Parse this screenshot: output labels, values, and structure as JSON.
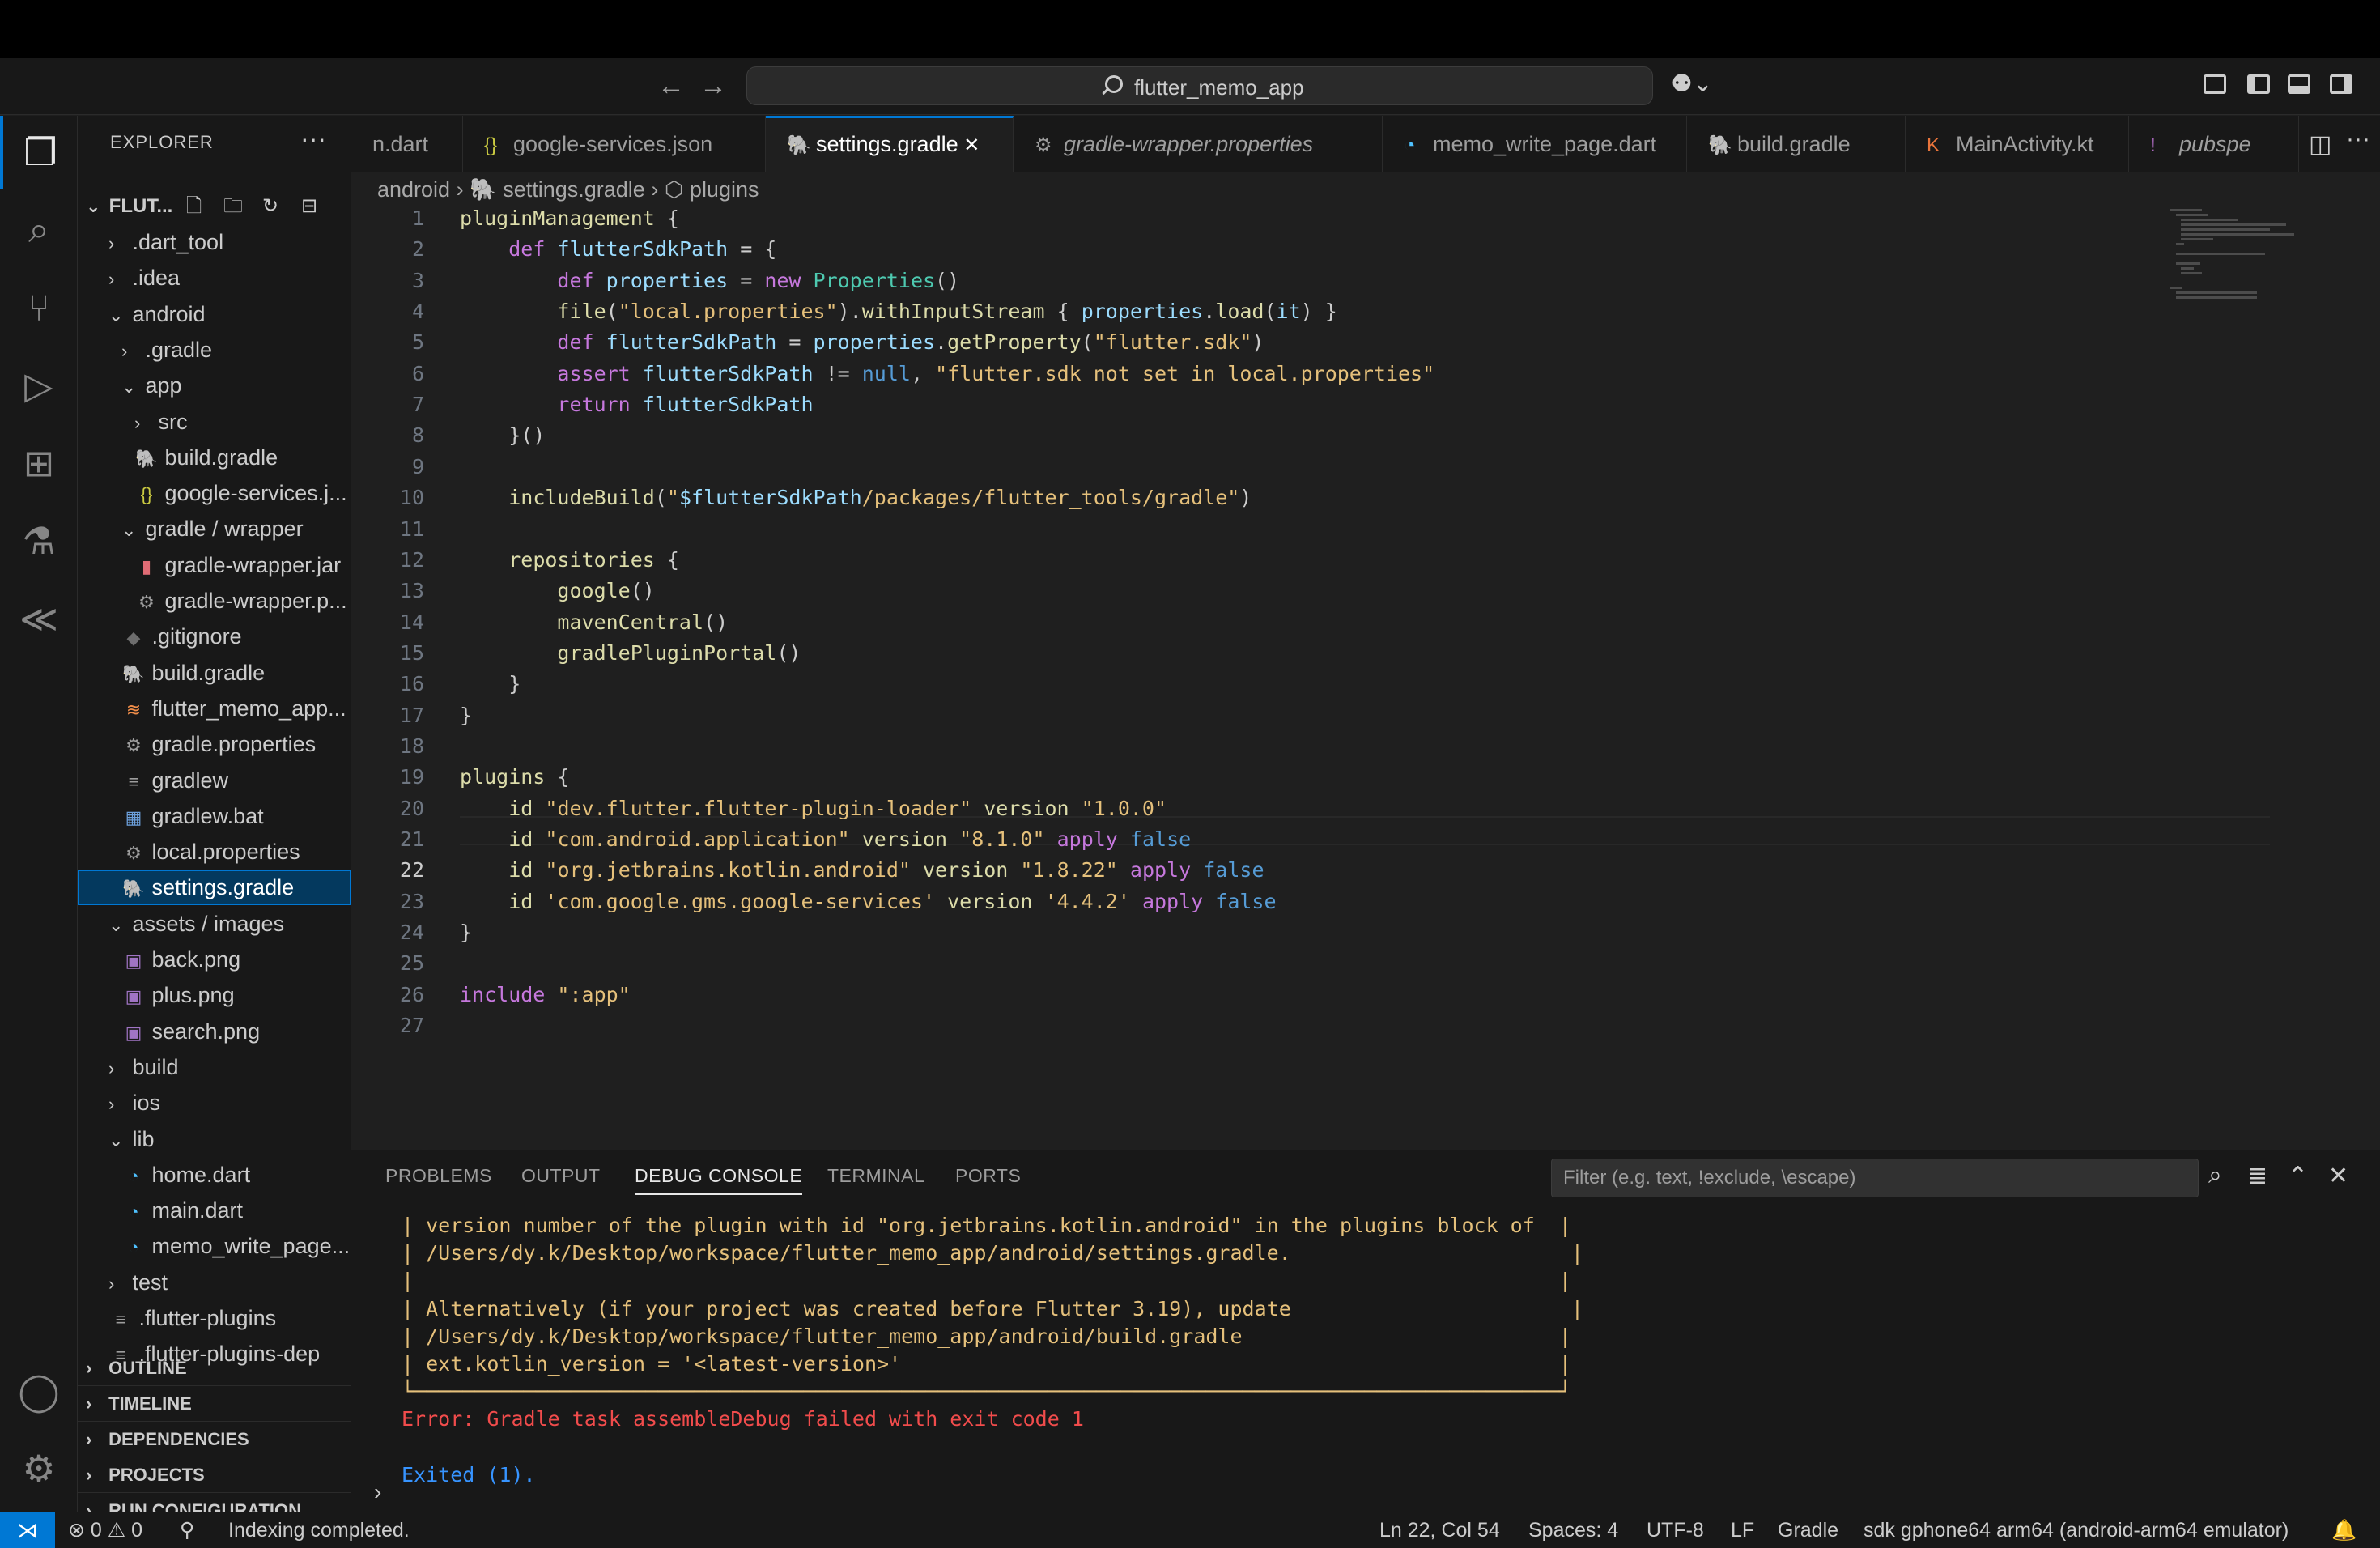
{
  "titlebar": {
    "search_text": "flutter_memo_app"
  },
  "sidebar": {
    "title": "EXPLORER",
    "root_label": "FLUT...",
    "tree": [
      {
        "label": ".dart_tool",
        "chev": "›",
        "icon": "",
        "indent": 0
      },
      {
        "label": ".idea",
        "chev": "›",
        "icon": "",
        "indent": 0
      },
      {
        "label": "android",
        "chev": "⌄",
        "icon": "",
        "indent": 0
      },
      {
        "label": ".gradle",
        "chev": "›",
        "icon": "",
        "indent": 1
      },
      {
        "label": "app",
        "chev": "⌄",
        "icon": "",
        "indent": 1
      },
      {
        "label": "src",
        "chev": "›",
        "icon": "",
        "indent": 2
      },
      {
        "label": "build.gradle",
        "chev": "",
        "icon": "🐘",
        "indent": 2
      },
      {
        "label": "google-services.j...",
        "chev": "",
        "icon": "{}",
        "indent": 2
      },
      {
        "label": "gradle / wrapper",
        "chev": "⌄",
        "icon": "",
        "indent": 1
      },
      {
        "label": "gradle-wrapper.jar",
        "chev": "",
        "icon": "▮",
        "indent": 2
      },
      {
        "label": "gradle-wrapper.p...",
        "chev": "",
        "icon": "⚙",
        "indent": 2
      },
      {
        "label": ".gitignore",
        "chev": "",
        "icon": "◆",
        "indent": 1
      },
      {
        "label": "build.gradle",
        "chev": "",
        "icon": "🐘",
        "indent": 1
      },
      {
        "label": "flutter_memo_app...",
        "chev": "",
        "icon": "≋",
        "indent": 1
      },
      {
        "label": "gradle.properties",
        "chev": "",
        "icon": "⚙",
        "indent": 1
      },
      {
        "label": "gradlew",
        "chev": "",
        "icon": "≡",
        "indent": 1
      },
      {
        "label": "gradlew.bat",
        "chev": "",
        "icon": "▦",
        "indent": 1
      },
      {
        "label": "local.properties",
        "chev": "",
        "icon": "⚙",
        "indent": 1
      },
      {
        "label": "settings.gradle",
        "chev": "",
        "icon": "🐘",
        "indent": 1,
        "selected": true
      },
      {
        "label": "assets / images",
        "chev": "⌄",
        "icon": "",
        "indent": 0
      },
      {
        "label": "back.png",
        "chev": "",
        "icon": "▣",
        "indent": 1
      },
      {
        "label": "plus.png",
        "chev": "",
        "icon": "▣",
        "indent": 1
      },
      {
        "label": "search.png",
        "chev": "",
        "icon": "▣",
        "indent": 1
      },
      {
        "label": "build",
        "chev": "›",
        "icon": "",
        "indent": 0
      },
      {
        "label": "ios",
        "chev": "›",
        "icon": "",
        "indent": 0
      },
      {
        "label": "lib",
        "chev": "⌄",
        "icon": "",
        "indent": 0
      },
      {
        "label": "home.dart",
        "chev": "",
        "icon": "◔",
        "indent": 1
      },
      {
        "label": "main.dart",
        "chev": "",
        "icon": "◔",
        "indent": 1
      },
      {
        "label": "memo_write_page....",
        "chev": "",
        "icon": "◔",
        "indent": 1
      },
      {
        "label": "test",
        "chev": "›",
        "icon": "",
        "indent": 0
      },
      {
        "label": ".flutter-plugins",
        "chev": "",
        "icon": "≡",
        "indent": 0
      },
      {
        "label": ".flutter-plugins-dep",
        "chev": "",
        "icon": "≡",
        "indent": 0
      }
    ],
    "sections": [
      "OUTLINE",
      "TIMELINE",
      "DEPENDENCIES",
      "PROJECTS",
      "RUN CONFIGURATION"
    ]
  },
  "tabs": [
    {
      "label": "n.dart",
      "icon": ""
    },
    {
      "label": "google-services.json",
      "icon": "{}"
    },
    {
      "label": "settings.gradle",
      "icon": "🐘",
      "active": true
    },
    {
      "label": "gradle-wrapper.properties",
      "icon": "⚙"
    },
    {
      "label": "memo_write_page.dart",
      "icon": "◔"
    },
    {
      "label": "build.gradle",
      "icon": "🐘"
    },
    {
      "label": "MainActivity.kt",
      "icon": "K"
    },
    {
      "label": "pubspe",
      "icon": "!"
    }
  ],
  "breadcrumb": {
    "part1": "android",
    "part2": "settings.gradle",
    "part3": "plugins"
  },
  "editor": {
    "current_line": 22,
    "lines": [
      "pluginManagement {",
      "    def flutterSdkPath = {",
      "        def properties = new Properties()",
      "        file(\"local.properties\").withInputStream { properties.load(it) }",
      "        def flutterSdkPath = properties.getProperty(\"flutter.sdk\")",
      "        assert flutterSdkPath != null, \"flutter.sdk not set in local.properties\"",
      "        return flutterSdkPath",
      "    }()",
      "",
      "    includeBuild(\"$flutterSdkPath/packages/flutter_tools/gradle\")",
      "",
      "    repositories {",
      "        google()",
      "        mavenCentral()",
      "        gradlePluginPortal()",
      "    }",
      "}",
      "",
      "plugins {",
      "    id \"dev.flutter.flutter-plugin-loader\" version \"1.0.0\"",
      "    id \"com.android.application\" version \"8.1.0\" apply false",
      "    id \"org.jetbrains.kotlin.android\" version \"1.8.22\" apply false",
      "    id 'com.google.gms.google-services' version '4.4.2' apply false",
      "}",
      "",
      "include \":app\"",
      ""
    ]
  },
  "panel": {
    "tabs": [
      "PROBLEMS",
      "OUTPUT",
      "DEBUG CONSOLE",
      "TERMINAL",
      "PORTS"
    ],
    "active_tab": "DEBUG CONSOLE",
    "filter_placeholder": "Filter (e.g. text, !exclude, \\escape)",
    "console": [
      {
        "text": "| version number of the plugin with id \"org.jetbrains.kotlin.android\" in the plugins block of  |",
        "kind": "y"
      },
      {
        "text": "| /Users/dy.k/Desktop/workspace/flutter_memo_app/android/settings.gradle.                       |",
        "kind": "y"
      },
      {
        "text": "|                                                                                              |",
        "kind": "y"
      },
      {
        "text": "| Alternatively (if your project was created before Flutter 3.19), update                       |",
        "kind": "y"
      },
      {
        "text": "| /Users/dy.k/Desktop/workspace/flutter_memo_app/android/build.gradle                          |",
        "kind": "y"
      },
      {
        "text": "| ext.kotlin_version = '<latest-version>'                                                      |",
        "kind": "y"
      },
      {
        "text": "└──────────────────────────────────────────────────────────────────────────────────────────────┘",
        "kind": "y"
      },
      {
        "text": "Error: Gradle task assembleDebug failed with exit code 1",
        "kind": "r"
      },
      {
        "text": "",
        "kind": "y"
      },
      {
        "text": "Exited (1).",
        "kind": "b"
      }
    ]
  },
  "statusbar": {
    "errors": "0",
    "warnings": "0",
    "message": "Indexing completed.",
    "position": "Ln 22, Col 54",
    "spaces": "Spaces: 4",
    "encoding": "UTF-8",
    "eol": "LF",
    "language": "Gradle",
    "device": "sdk gphone64 arm64 (android-arm64 emulator)"
  },
  "colors": {
    "accent": "#0078d4",
    "selection": "#04395e"
  }
}
